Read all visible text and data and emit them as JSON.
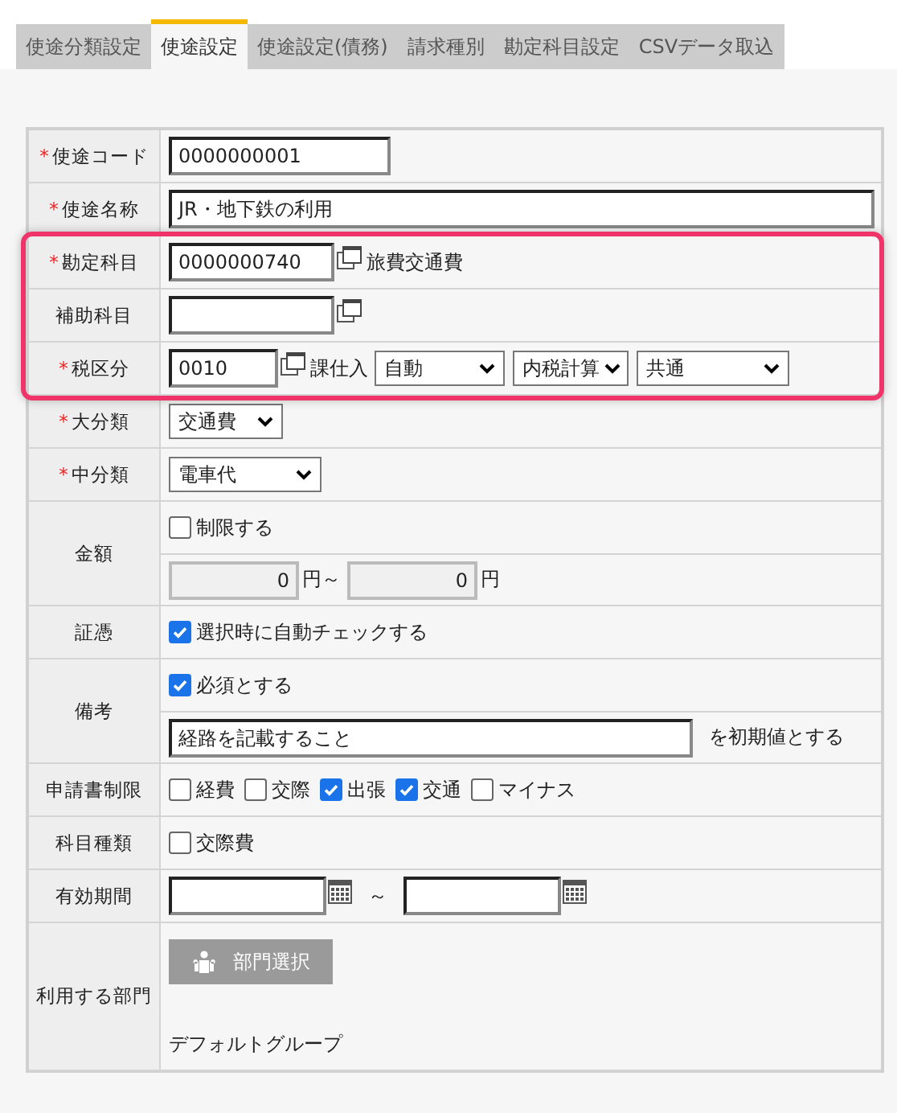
{
  "tabs": [
    {
      "label": "使途分類設定",
      "selected": false
    },
    {
      "label": "使途設定",
      "selected": true
    },
    {
      "label": "使途設定(債務)",
      "selected": false
    },
    {
      "label": "請求種別",
      "selected": false
    },
    {
      "label": "勘定科目設定",
      "selected": false
    },
    {
      "label": "CSVデータ取込",
      "selected": false
    }
  ],
  "required_mark": "*",
  "rows": [
    {
      "label": "使途コード",
      "required": true,
      "highlighted": false,
      "kind": "text",
      "value": "0000000001"
    },
    {
      "label": "使途名称",
      "required": true,
      "highlighted": false,
      "kind": "text",
      "value": "JR・地下鉄の利用"
    },
    {
      "label": "勘定科目",
      "required": true,
      "highlighted": true,
      "kind": "lookup",
      "value": "0000000740",
      "name": "旅費交通費"
    },
    {
      "label": "補助科目",
      "required": false,
      "highlighted": true,
      "kind": "lookup"
    },
    {
      "label": "税区分",
      "required": true,
      "highlighted": true,
      "kind": "tax",
      "value": "0010",
      "name": "課仕入",
      "selects": [
        "自動",
        "内税計算",
        "共通"
      ]
    },
    {
      "label": "大分類",
      "required": true,
      "highlighted": false,
      "kind": "select",
      "value": "交通費"
    },
    {
      "label": "中分類",
      "required": true,
      "highlighted": false,
      "kind": "select",
      "value": "電車代"
    },
    {
      "label": "金額",
      "required": false,
      "highlighted": false,
      "kind": "amount",
      "check": {
        "label": "制限する",
        "checked": false
      },
      "min": "0",
      "unit_from": "円～",
      "max": "0",
      "unit_to": "円"
    },
    {
      "label": "証憑",
      "required": false,
      "highlighted": false,
      "kind": "checks",
      "checks": [
        {
          "label": "選択時に自動チェックする",
          "checked": true
        }
      ]
    },
    {
      "label": "備考",
      "required": false,
      "highlighted": false,
      "kind": "remark",
      "check": {
        "label": "必須とする",
        "checked": true
      },
      "value": "経路を記載すること",
      "suffix": "を初期値とする"
    },
    {
      "label": "申請書制限",
      "required": false,
      "highlighted": false,
      "kind": "checks",
      "checks": [
        {
          "label": "経費",
          "checked": false
        },
        {
          "label": "交際",
          "checked": false
        },
        {
          "label": "出張",
          "checked": true
        },
        {
          "label": "交通",
          "checked": true
        },
        {
          "label": "マイナス",
          "checked": false
        }
      ]
    },
    {
      "label": "科目種類",
      "required": false,
      "highlighted": false,
      "kind": "checks",
      "checks": [
        {
          "label": "交際費",
          "checked": false
        }
      ]
    },
    {
      "label": "有効期間",
      "required": false,
      "highlighted": false,
      "kind": "period",
      "separator": "～"
    },
    {
      "label": "利用する部門",
      "required": false,
      "highlighted": false,
      "kind": "dept",
      "button": "部門選択",
      "group": "デフォルトグループ"
    }
  ]
}
